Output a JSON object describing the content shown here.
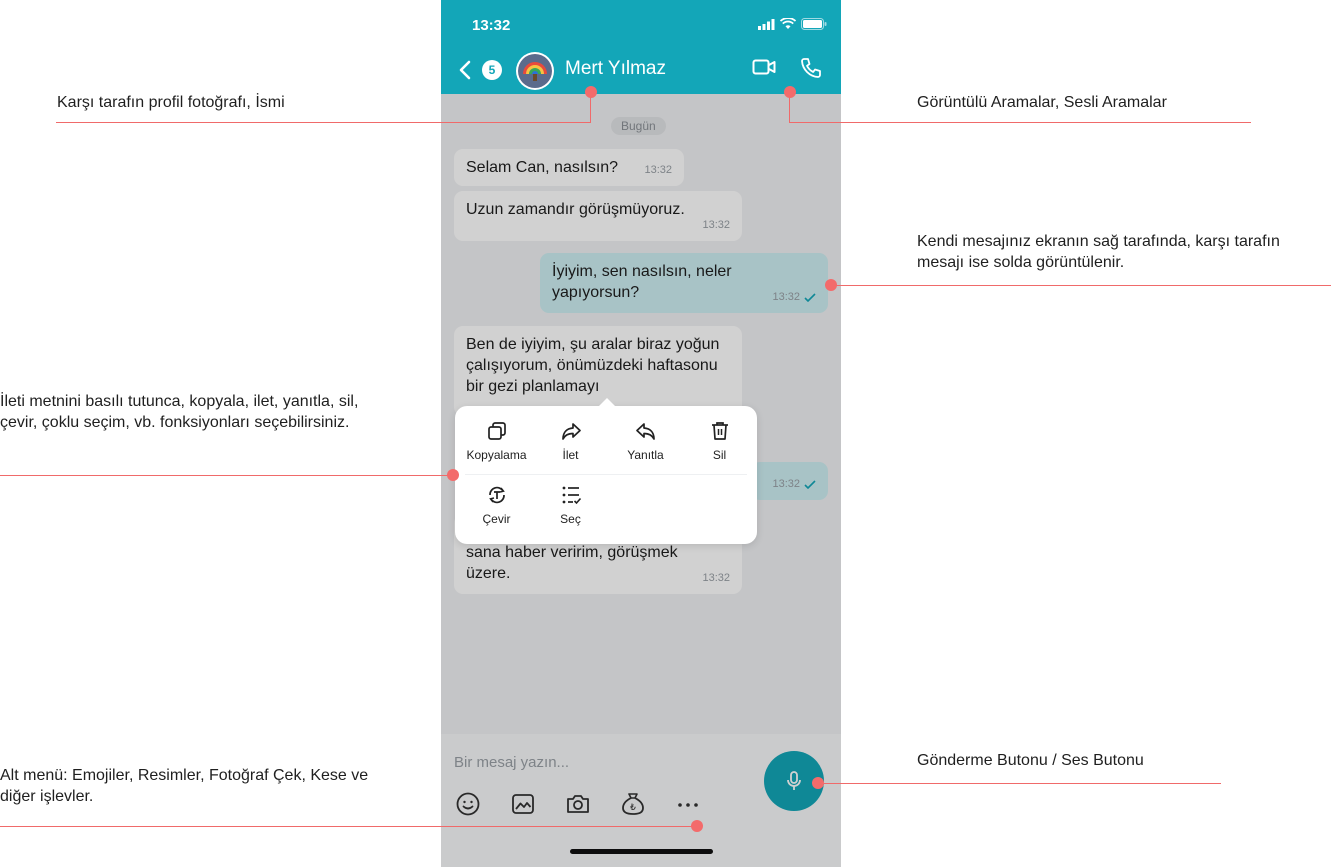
{
  "status_bar": {
    "time": "13:32"
  },
  "header": {
    "badge_count": "5",
    "contact_name": "Mert Yılmaz"
  },
  "chat": {
    "date_label": "Bugün",
    "messages": [
      {
        "from": "other",
        "text": "Selam Can, nasılsın?",
        "time": "13:32"
      },
      {
        "from": "other",
        "text": "Uzun zamandır görüşmüyoruz.",
        "time": "13:32"
      },
      {
        "from": "me",
        "text": "İyiyim, sen nasılsın, neler yapıyorsun?",
        "time": "13:32"
      },
      {
        "from": "other",
        "text": "Ben de iyiyim, şu aralar biraz yoğun çalışıyorum, önümüzdeki haftasonu bir gezi planlamayı",
        "time": ""
      },
      {
        "from": "me",
        "text": "",
        "time": "13:32"
      },
      {
        "from": "other",
        "text": "sana haber veririm, görüşmek üzere.",
        "time": "13:32"
      }
    ]
  },
  "context_menu": {
    "items": [
      {
        "label": "Kopyalama",
        "icon": "copy-icon"
      },
      {
        "label": "İlet",
        "icon": "forward-icon"
      },
      {
        "label": "Yanıtla",
        "icon": "reply-icon"
      },
      {
        "label": "Sil",
        "icon": "trash-icon"
      },
      {
        "label": "Çevir",
        "icon": "translate-icon"
      },
      {
        "label": "Seç",
        "icon": "select-list-icon"
      }
    ]
  },
  "input": {
    "placeholder": "Bir mesaj yazın..."
  },
  "toolbar": {
    "icons": [
      "emoji-icon",
      "image-icon",
      "camera-icon",
      "money-bag-icon",
      "more-icon"
    ]
  },
  "annotations": {
    "profile": "Karşı tarafın profil fotoğrafı, İsmi",
    "calls": "Görüntülü Aramalar, Sesli Aramalar",
    "messages": "Kendi mesajınız ekranın sağ tarafında, karşı tarafın mesajı ise solda görüntülenir.",
    "longpress": "İleti metnini basılı tutunca, kopyala, ilet, yanıtla, sil, çevir, çoklu seçim, vb. fonksiyonları seçebilirsiniz.",
    "send": "Gönderme Butonu / Ses Butonu",
    "bottom_menu": "Alt menü: Emojiler, Resimler, Fotoğraf Çek, Kese ve diğer işlevler."
  },
  "colors": {
    "accent": "#13a6b8",
    "annotation_line": "#f06a6a",
    "my_bubble": "#cdeef2"
  }
}
